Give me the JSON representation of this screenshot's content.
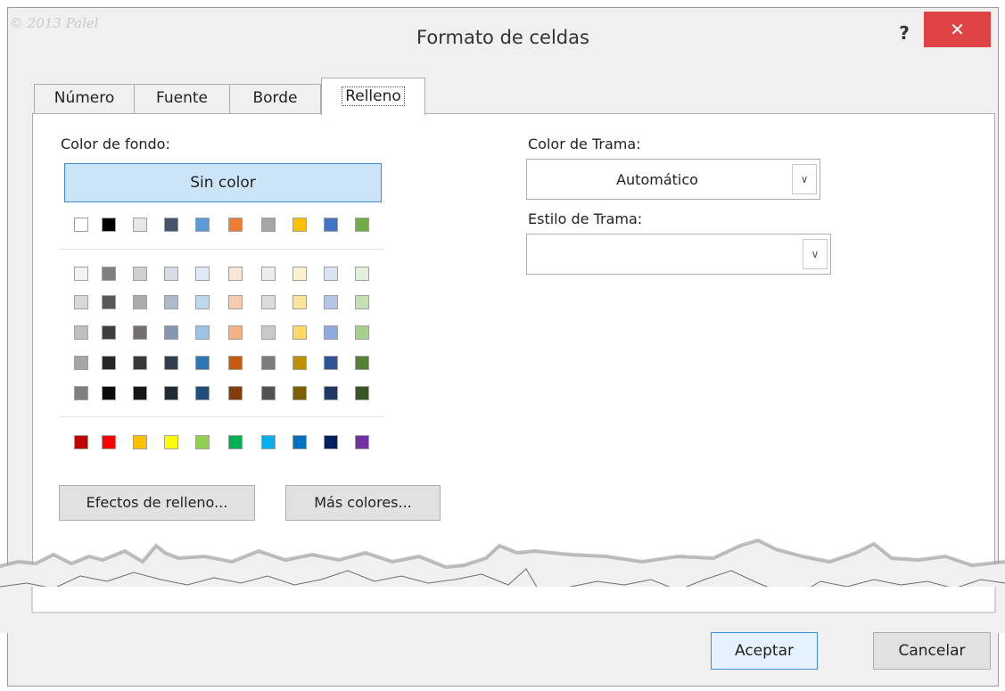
{
  "window": {
    "title": "Formato de celdas",
    "watermark": "© 2013 Palel",
    "help_label": "?",
    "close_label": "✕"
  },
  "tabs": [
    {
      "label": "Número",
      "active": false
    },
    {
      "label": "Fuente",
      "active": false
    },
    {
      "label": "Borde",
      "active": false
    },
    {
      "label": "Relleno",
      "active": true
    }
  ],
  "fill": {
    "background_color_label": "Color de fondo:",
    "no_color_button": "Sin color",
    "theme_top_row": [
      "#ffffff",
      "#000000",
      "#e7e6e6",
      "#44546a",
      "#5b9bd5",
      "#ed7d31",
      "#a5a5a5",
      "#ffc000",
      "#4472c4",
      "#70ad47"
    ],
    "theme_tints": [
      [
        "#f2f2f2",
        "#808080",
        "#d0cece",
        "#d6dce4",
        "#deebf6",
        "#fbe5d5",
        "#ededed",
        "#fff2cc",
        "#dae3f3",
        "#e2efd9"
      ],
      [
        "#d8d8d8",
        "#595959",
        "#aeabab",
        "#adb9ca",
        "#bdd7ee",
        "#f7cbac",
        "#dbdbdb",
        "#fee599",
        "#b4c6e7",
        "#c5e0b3"
      ],
      [
        "#bfbfbf",
        "#3f3f3f",
        "#757070",
        "#8496b0",
        "#9cc3e5",
        "#f4b183",
        "#c9c9c9",
        "#ffd965",
        "#8faadc",
        "#a8d08d"
      ],
      [
        "#a5a5a5",
        "#262626",
        "#3a3838",
        "#323f4f",
        "#2e75b5",
        "#c55a11",
        "#7b7b7b",
        "#bf9000",
        "#2f5496",
        "#538135"
      ],
      [
        "#7f7f7f",
        "#0c0c0c",
        "#171616",
        "#222a35",
        "#1e4e79",
        "#833c0b",
        "#525252",
        "#7f6000",
        "#1f3864",
        "#375623"
      ]
    ],
    "standard_colors": [
      "#c00000",
      "#ff0000",
      "#ffc000",
      "#ffff00",
      "#92d050",
      "#00b050",
      "#00b0f0",
      "#0070c0",
      "#002060",
      "#7030a0"
    ],
    "fill_effects_button": "Efectos de relleno...",
    "more_colors_button": "Más colores...",
    "pattern_color_label": "Color de Trama:",
    "pattern_color_value": "Automático",
    "pattern_style_label": "Estilo de Trama:",
    "pattern_style_value": ""
  },
  "footer": {
    "ok_button": "Aceptar",
    "cancel_button": "Cancelar"
  }
}
